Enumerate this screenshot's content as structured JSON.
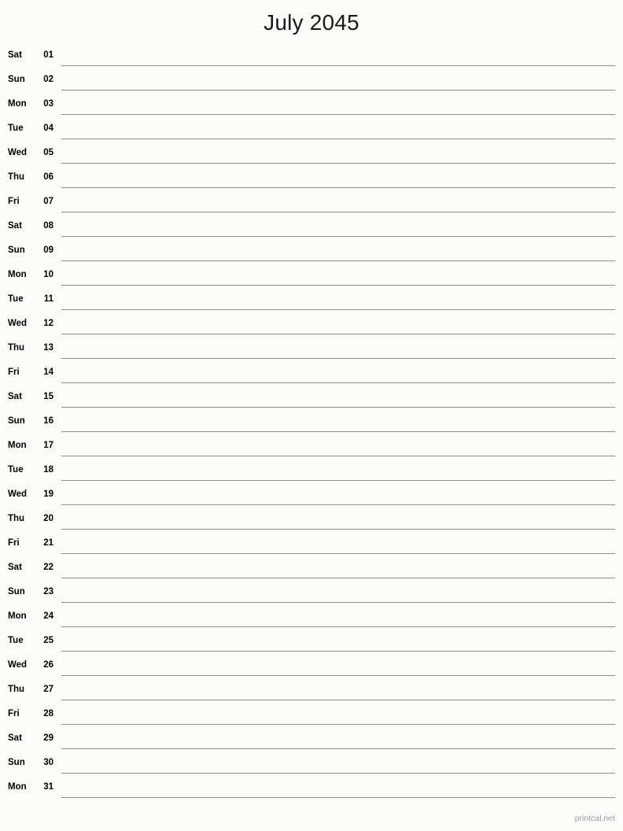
{
  "page": {
    "title": "July 2045",
    "background_color": "#fbfcf8",
    "rule_color": "#8a8f88",
    "text_color": "#000000"
  },
  "footer": {
    "brand": "printcal.net",
    "color": "#9a9a9a"
  },
  "calendar": {
    "month": "July",
    "year": "2045",
    "first_weekday": "Sat",
    "days_in_month": 31,
    "rows": [
      {
        "weekday": "Sat",
        "date": "01"
      },
      {
        "weekday": "Sun",
        "date": "02"
      },
      {
        "weekday": "Mon",
        "date": "03"
      },
      {
        "weekday": "Tue",
        "date": "04"
      },
      {
        "weekday": "Wed",
        "date": "05"
      },
      {
        "weekday": "Thu",
        "date": "06"
      },
      {
        "weekday": "Fri",
        "date": "07"
      },
      {
        "weekday": "Sat",
        "date": "08"
      },
      {
        "weekday": "Sun",
        "date": "09"
      },
      {
        "weekday": "Mon",
        "date": "10"
      },
      {
        "weekday": "Tue",
        "date": "11"
      },
      {
        "weekday": "Wed",
        "date": "12"
      },
      {
        "weekday": "Thu",
        "date": "13"
      },
      {
        "weekday": "Fri",
        "date": "14"
      },
      {
        "weekday": "Sat",
        "date": "15"
      },
      {
        "weekday": "Sun",
        "date": "16"
      },
      {
        "weekday": "Mon",
        "date": "17"
      },
      {
        "weekday": "Tue",
        "date": "18"
      },
      {
        "weekday": "Wed",
        "date": "19"
      },
      {
        "weekday": "Thu",
        "date": "20"
      },
      {
        "weekday": "Fri",
        "date": "21"
      },
      {
        "weekday": "Sat",
        "date": "22"
      },
      {
        "weekday": "Sun",
        "date": "23"
      },
      {
        "weekday": "Mon",
        "date": "24"
      },
      {
        "weekday": "Tue",
        "date": "25"
      },
      {
        "weekday": "Wed",
        "date": "26"
      },
      {
        "weekday": "Thu",
        "date": "27"
      },
      {
        "weekday": "Fri",
        "date": "28"
      },
      {
        "weekday": "Sat",
        "date": "29"
      },
      {
        "weekday": "Sun",
        "date": "30"
      },
      {
        "weekday": "Mon",
        "date": "31"
      }
    ]
  }
}
